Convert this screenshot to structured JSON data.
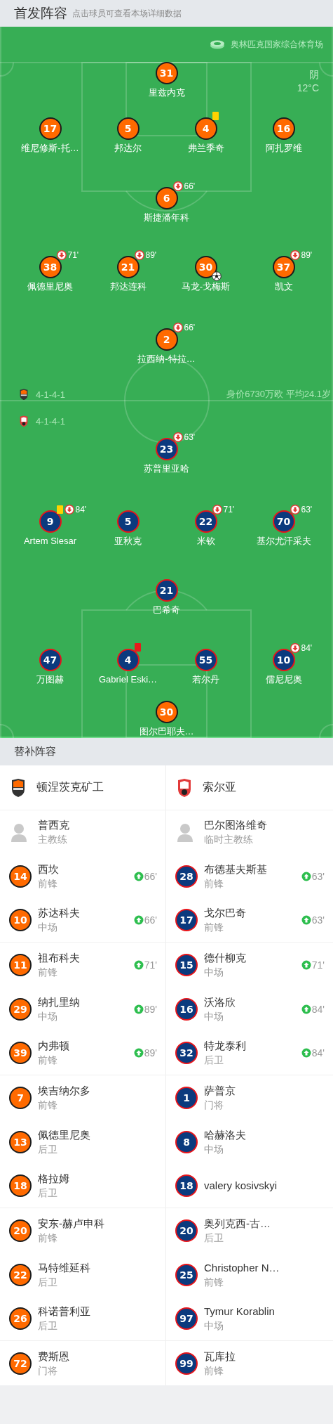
{
  "header": {
    "title": "首发阵容",
    "subtitle": "点击球员可查看本场详细数据"
  },
  "pitch": {
    "stadium": "奥林匹克国家综合体育场",
    "weather": "阴",
    "temperature": "12°C",
    "value_summary": "身价6730万欧 平均24.1岁",
    "home": {
      "formation": "4-1-4-1",
      "lines": [
        [
          {
            "number": "31",
            "name": "里兹内克",
            "color": "#ff6a00"
          }
        ],
        [
          {
            "number": "17",
            "name": "维尼修斯-托…",
            "color": "#ff6a00"
          },
          {
            "number": "5",
            "name": "邦达尔",
            "color": "#ff6a00"
          },
          {
            "number": "4",
            "name": "弗兰季奇",
            "color": "#ff6a00",
            "yellow_card": true
          },
          {
            "number": "16",
            "name": "阿扎罗维",
            "color": "#ff6a00"
          }
        ],
        [
          {
            "number": "6",
            "name": "斯捷潘年科",
            "color": "#ff6a00",
            "sub_off": "66'"
          }
        ],
        [
          {
            "number": "38",
            "name": "佩德里尼奥",
            "color": "#ff6a00",
            "sub_off": "71'"
          },
          {
            "number": "21",
            "name": "邦达连科",
            "color": "#ff6a00",
            "sub_off": "89'"
          },
          {
            "number": "30",
            "name": "马龙-戈梅斯",
            "color": "#ff6a00",
            "goal": true
          },
          {
            "number": "37",
            "name": "凯文",
            "color": "#ff6a00",
            "sub_off": "89'"
          }
        ],
        [
          {
            "number": "2",
            "name": "拉西纳-特拉…",
            "color": "#ff6a00",
            "sub_off": "66'"
          }
        ]
      ]
    },
    "away": {
      "formation": "4-1-4-1",
      "lines": [
        [
          {
            "number": "23",
            "name": "苏普里亚哈",
            "color": "#0b3a7e",
            "sub_off": "63'"
          }
        ],
        [
          {
            "number": "9",
            "name": "Artem Slesar",
            "color": "#0b3a7e",
            "yellow_card": true,
            "sub_off": "84'"
          },
          {
            "number": "5",
            "name": "亚秋克",
            "color": "#0b3a7e"
          },
          {
            "number": "22",
            "name": "米钦",
            "color": "#0b3a7e",
            "sub_off": "71'"
          },
          {
            "number": "70",
            "name": "基尔尤汗采夫",
            "color": "#0b3a7e",
            "sub_off": "63'"
          }
        ],
        [
          {
            "number": "21",
            "name": "巴希奇",
            "color": "#0b3a7e"
          }
        ],
        [
          {
            "number": "47",
            "name": "万图赫",
            "color": "#0b3a7e"
          },
          {
            "number": "4",
            "name": "Gabriel Eski…",
            "color": "#0b3a7e",
            "red_card": true
          },
          {
            "number": "55",
            "name": "若尔丹",
            "color": "#0b3a7e"
          },
          {
            "number": "10",
            "name": "儒尼尼奥",
            "color": "#0b3a7e",
            "sub_off": "84'"
          }
        ],
        [
          {
            "number": "30",
            "name": "图尔巴耶夫…",
            "color": "#ff6a00",
            "keeper": true
          }
        ]
      ]
    }
  },
  "substitutes": {
    "title": "替补阵容",
    "teams": [
      {
        "name": "顿涅茨克矿工",
        "color": "#ff6a00"
      },
      {
        "name": "索尔亚",
        "color": "#0b3a7e"
      }
    ],
    "coaches": [
      {
        "name": "普西克",
        "role": "主教练"
      },
      {
        "name": "巴尔图洛维奇",
        "role": "临时主教练"
      }
    ],
    "rows": [
      {
        "home": {
          "number": "14",
          "name": "西坎",
          "position": "前锋",
          "sub_on": "66'"
        },
        "away": {
          "number": "28",
          "name": "布德基夫斯基",
          "position": "前锋",
          "sub_on": "63'"
        }
      },
      {
        "home": {
          "number": "10",
          "name": "苏达科夫",
          "position": "中场",
          "sub_on": "66'"
        },
        "away": {
          "number": "17",
          "name": "戈尔巴奇",
          "position": "前锋",
          "sub_on": "63'"
        }
      },
      {
        "home": {
          "number": "11",
          "name": "祖布科夫",
          "position": "前锋",
          "sub_on": "71'"
        },
        "away": {
          "number": "15",
          "name": "德什柳克",
          "position": "中场",
          "sub_on": "71'"
        }
      },
      {
        "home": {
          "number": "29",
          "name": "纳扎里纳",
          "position": "中场",
          "sub_on": "89'"
        },
        "away": {
          "number": "16",
          "name": "沃洛欣",
          "position": "中场",
          "sub_on": "84'"
        }
      },
      {
        "home": {
          "number": "39",
          "name": "内弗顿",
          "position": "前锋",
          "sub_on": "89'"
        },
        "away": {
          "number": "32",
          "name": "特龙泰利",
          "position": "后卫",
          "sub_on": "84'"
        }
      },
      {
        "home": {
          "number": "7",
          "name": "埃吉纳尔多",
          "position": "前锋"
        },
        "away": {
          "number": "1",
          "name": "萨普京",
          "position": "门将"
        }
      },
      {
        "home": {
          "number": "13",
          "name": "佩德里尼奥",
          "position": "后卫"
        },
        "away": {
          "number": "8",
          "name": "哈赫洛夫",
          "position": "中场"
        }
      },
      {
        "home": {
          "number": "18",
          "name": "格拉姆",
          "position": "后卫"
        },
        "away": {
          "number": "18",
          "name": "valery kosivskyi"
        }
      },
      {
        "home": {
          "number": "20",
          "name": "安东-赫卢申科",
          "position": "前锋"
        },
        "away": {
          "number": "20",
          "name": "奥列克西-古…",
          "position": "后卫"
        }
      },
      {
        "home": {
          "number": "22",
          "name": "马特维延科",
          "position": "后卫"
        },
        "away": {
          "number": "25",
          "name": "Christopher N…",
          "position": "前锋"
        }
      },
      {
        "home": {
          "number": "26",
          "name": "科诺普利亚",
          "position": "后卫"
        },
        "away": {
          "number": "97",
          "name": "Tymur Korablin",
          "position": "中场"
        }
      },
      {
        "home": {
          "number": "72",
          "name": "费斯恩",
          "position": "门将"
        },
        "away": {
          "number": "99",
          "name": "瓦库拉",
          "position": "前锋"
        }
      }
    ]
  }
}
